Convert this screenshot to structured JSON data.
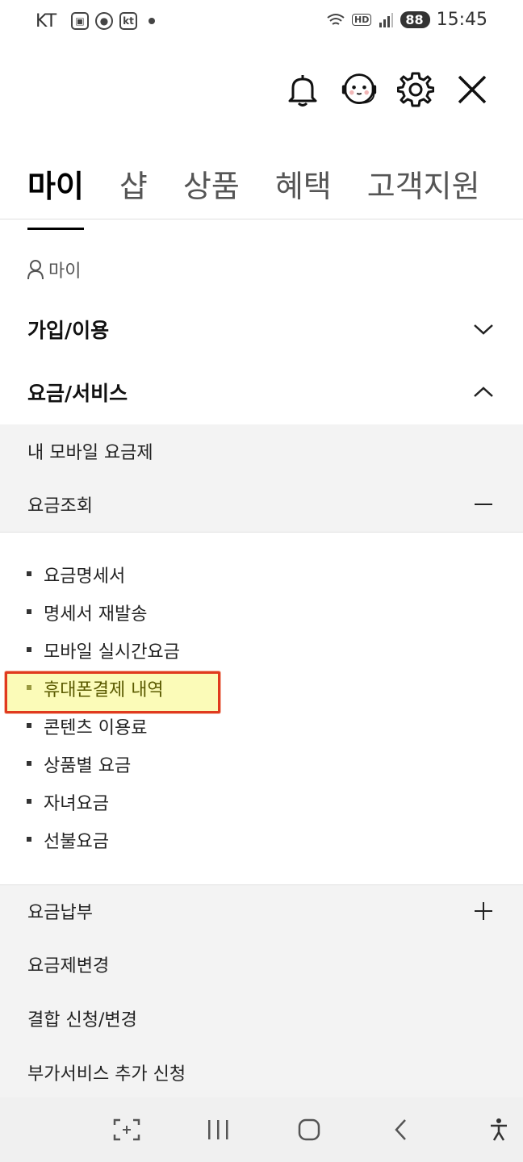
{
  "status_bar": {
    "carrier": "KT",
    "hd": "HD",
    "battery": "88",
    "time": "15:45",
    "left_icons": [
      "screenshot-icon",
      "pill-icon",
      "kt-app-icon"
    ]
  },
  "header": {
    "icons": [
      "bell-icon",
      "chatbot-icon",
      "gear-icon",
      "close-icon"
    ]
  },
  "tabs": [
    {
      "label": "마이",
      "active": true
    },
    {
      "label": "샵",
      "active": false
    },
    {
      "label": "상품",
      "active": false
    },
    {
      "label": "혜택",
      "active": false
    },
    {
      "label": "고객지원",
      "active": false
    }
  ],
  "breadcrumb": {
    "label": "마이"
  },
  "sections": {
    "join": {
      "label": "가입/이용"
    },
    "billing": {
      "label": "요금/서비스"
    }
  },
  "billing_menu": {
    "my_plan": "내 모바일 요금제",
    "inquiry": "요금조회",
    "inquiry_items": [
      "요금명세서",
      "명세서 재발송",
      "모바일 실시간요금",
      "휴대폰결제 내역",
      "콘텐츠 이용료",
      "상품별 요금",
      "자녀요금",
      "선불요금"
    ],
    "payment": "요금납부",
    "plan_change": "요금제변경",
    "bundle": "결합 신청/변경",
    "addon": "부가서비스 추가 신청"
  },
  "colors": {
    "highlight_fill": "#fbfbb8",
    "highlight_border": "#e03a1e"
  }
}
